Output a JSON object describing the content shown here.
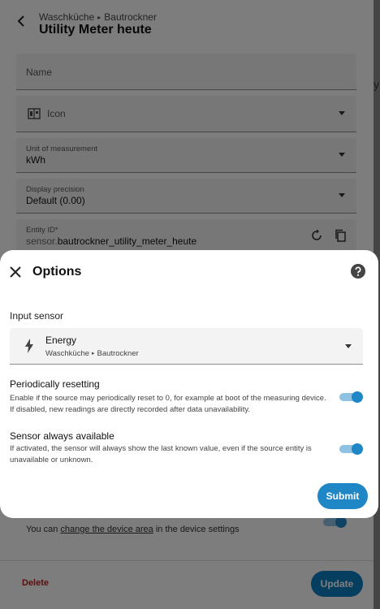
{
  "background": {
    "breadcrumb": {
      "device": "Waschküche",
      "entity": "Bautrockner"
    },
    "title": "Utility Meter heute",
    "fields": {
      "name_placeholder": "Name",
      "icon_placeholder": "Icon",
      "unit_label": "Unit of measurement",
      "unit_value": "kWh",
      "precision_label": "Display precision",
      "precision_value": "Default (0.00)",
      "entity_id_label": "Entity ID*",
      "entity_id_prefix": "sensor.",
      "entity_id_value": "bautrockner_utility_meter_heute"
    },
    "area_text_prefix": "You can ",
    "area_link": "change the device area",
    "area_text_suffix": " in the device settings",
    "delete_label": "Delete",
    "update_label": "Update"
  },
  "dialog": {
    "title": "Options",
    "input_sensor_label": "Input sensor",
    "sensor": {
      "name": "Energy",
      "area": "Waschküche",
      "device": "Bautrockner"
    },
    "options": [
      {
        "title": "Periodically resetting",
        "description": "Enable if the source may periodically reset to 0, for example at boot of the measuring device. If disabled, new readings are directly recorded after data unavailability.",
        "enabled": true
      },
      {
        "title": "Sensor always available",
        "description": "If activated, the sensor will always show the last known value, even if the source entity is unavailable or unknown.",
        "enabled": true
      }
    ],
    "submit_label": "Submit"
  },
  "colors": {
    "accent": "#2087c6",
    "toggle_track": "#8fc1e3",
    "delete": "#b71c1c"
  },
  "icons": {
    "back": "arrow-left-icon",
    "close": "close-icon",
    "help": "help-circle-icon",
    "sensor": "lightning-bolt-icon",
    "icon_field": "icon-picker-icon",
    "reset": "restore-icon",
    "copy": "copy-icon"
  }
}
